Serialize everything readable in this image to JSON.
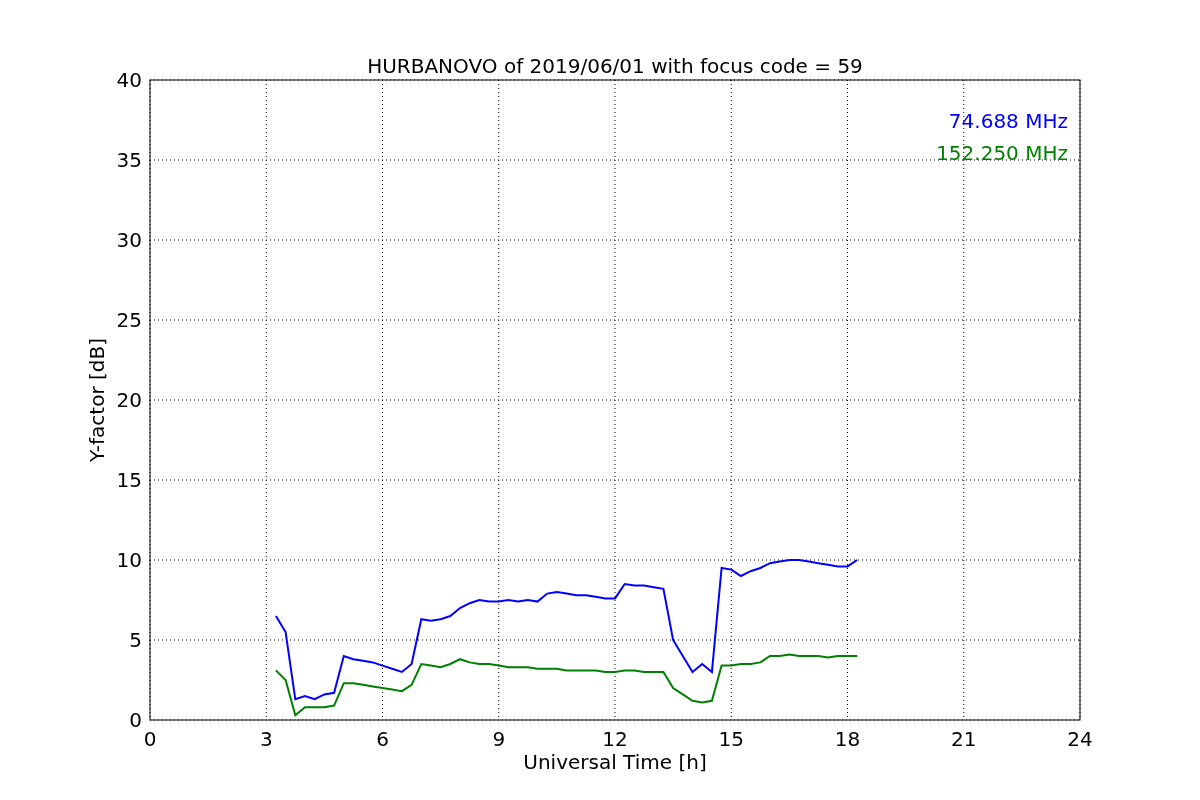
{
  "chart_data": {
    "type": "line",
    "title": "HURBANOVO of 2019/06/01 with focus code = 59",
    "xlabel": "Universal Time [h]",
    "ylabel": "Y-factor [dB]",
    "x": [
      3.25,
      3.5,
      3.75,
      4.0,
      4.25,
      4.5,
      4.75,
      5.0,
      5.25,
      5.5,
      5.75,
      6.0,
      6.25,
      6.5,
      6.75,
      7.0,
      7.25,
      7.5,
      7.75,
      8.0,
      8.25,
      8.5,
      8.75,
      9.0,
      9.25,
      9.5,
      9.75,
      10.0,
      10.25,
      10.5,
      10.75,
      11.0,
      11.25,
      11.5,
      11.75,
      12.0,
      12.25,
      12.5,
      12.75,
      13.0,
      13.25,
      13.5,
      13.75,
      14.0,
      14.25,
      14.5,
      14.75,
      15.0,
      15.25,
      15.5,
      15.75,
      16.0,
      16.25,
      16.5,
      16.75,
      17.0,
      17.25,
      17.5,
      17.75,
      18.0,
      18.25
    ],
    "series": [
      {
        "name": "74.688 MHz",
        "color": "#0000ff",
        "values": [
          6.5,
          5.5,
          1.3,
          1.5,
          1.3,
          1.6,
          1.7,
          4.0,
          3.8,
          3.7,
          3.6,
          3.4,
          3.2,
          3.0,
          3.5,
          6.3,
          6.2,
          6.3,
          6.5,
          7.0,
          7.3,
          7.5,
          7.4,
          7.4,
          7.5,
          7.4,
          7.5,
          7.4,
          7.9,
          8.0,
          7.9,
          7.8,
          7.8,
          7.7,
          7.6,
          7.6,
          8.5,
          8.4,
          8.4,
          8.3,
          8.2,
          5.0,
          4.0,
          3.0,
          3.5,
          3.0,
          9.5,
          9.4,
          9.0,
          9.3,
          9.5,
          9.8,
          9.9,
          10.0,
          10.0,
          9.9,
          9.8,
          9.7,
          9.6,
          9.6,
          10.0
        ]
      },
      {
        "name": "152.250 MHz",
        "color": "#008000",
        "values": [
          3.1,
          2.5,
          0.3,
          0.8,
          0.8,
          0.8,
          0.9,
          2.3,
          2.3,
          2.2,
          2.1,
          2.0,
          1.9,
          1.8,
          2.2,
          3.5,
          3.4,
          3.3,
          3.5,
          3.8,
          3.6,
          3.5,
          3.5,
          3.4,
          3.3,
          3.3,
          3.3,
          3.2,
          3.2,
          3.2,
          3.1,
          3.1,
          3.1,
          3.1,
          3.0,
          3.0,
          3.1,
          3.1,
          3.0,
          3.0,
          3.0,
          2.0,
          1.6,
          1.2,
          1.1,
          1.2,
          3.4,
          3.4,
          3.5,
          3.5,
          3.6,
          4.0,
          4.0,
          4.1,
          4.0,
          4.0,
          4.0,
          3.9,
          4.0,
          4.0,
          4.0
        ]
      }
    ],
    "xlim": [
      0,
      24
    ],
    "ylim": [
      0,
      40
    ],
    "xticks": [
      0,
      3,
      6,
      9,
      12,
      15,
      18,
      21,
      24
    ],
    "yticks": [
      0,
      5,
      10,
      15,
      20,
      25,
      30,
      35,
      40
    ],
    "grid": true
  }
}
